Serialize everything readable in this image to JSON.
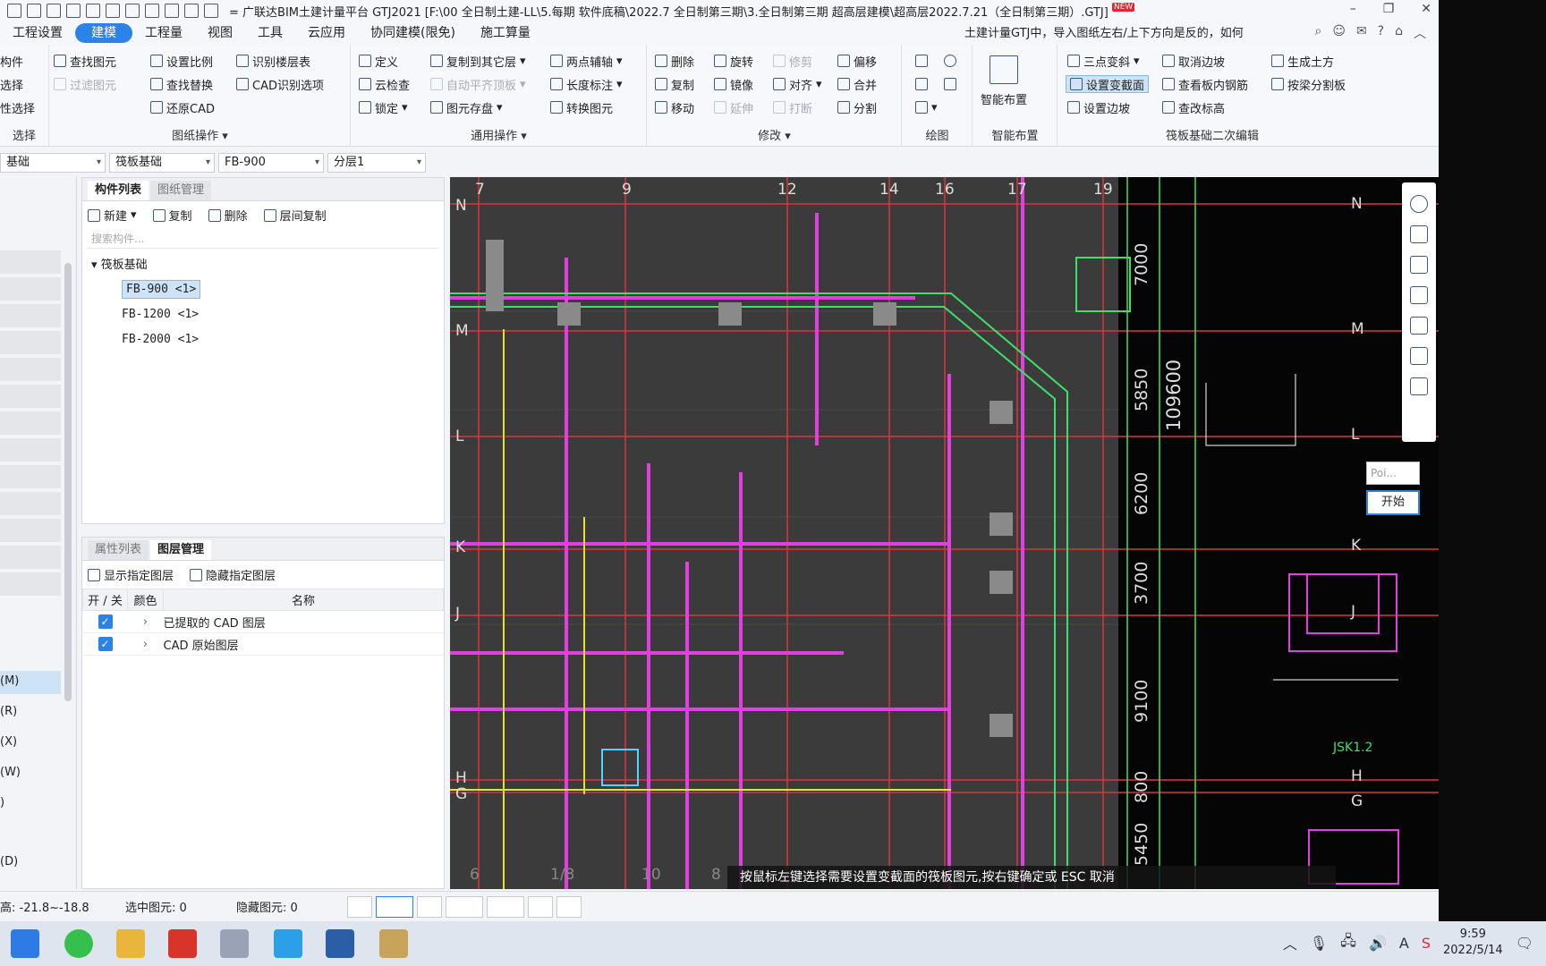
{
  "titlebar": {
    "title": "= 广联达BIM土建计量平台 GTJ2021 [F:\\00 全日制土建-LL\\5.每期 软件底稿\\2022.7 全日制第三期\\3.全日制第三期 超高层建模\\超高层2022.7.21（全日制第三期）.GTJ]",
    "new_badge": "NEW"
  },
  "menubar": {
    "items": [
      "工程设置",
      "建模",
      "工程量",
      "视图",
      "工具",
      "云应用",
      "协同建模(限免)",
      "施工算量"
    ],
    "active": "建模",
    "tip": "土建计量GTJ中，导入图纸左右/上下方向是反的，如何"
  },
  "ribbon": {
    "select_group": {
      "title": "选择",
      "items": [
        "构件",
        "选择",
        "性选择"
      ]
    },
    "drawing_ops": {
      "title": "图纸操作",
      "items": [
        "查找图元",
        "过滤图元",
        "设置比例",
        "查找替换",
        "还原CAD",
        "识别楼层表",
        "CAD识别选项"
      ]
    },
    "common_ops": {
      "title": "通用操作",
      "items": [
        "定义",
        "云检查",
        "锁定",
        "复制到其它层",
        "自动平齐顶板",
        "图元存盘",
        "两点辅轴",
        "长度标注",
        "转换图元"
      ]
    },
    "modify": {
      "title": "修改",
      "items": [
        "删除",
        "旋转",
        "修剪",
        "偏移",
        "复制",
        "镜像",
        "对齐",
        "合并",
        "移动",
        "延伸",
        "打断",
        "分割"
      ]
    },
    "draw": {
      "title": "绘图"
    },
    "smart": {
      "title": "智能布置",
      "label": "智能布置"
    },
    "raft_edit": {
      "title": "筏板基础二次编辑",
      "items": [
        "三点变斜",
        "取消边坡",
        "生成土方",
        "设置变截面",
        "查看板内钢筋",
        "按梁分割板",
        "设置边坡",
        "查改标高"
      ]
    }
  },
  "selbar": {
    "combos": [
      "基础",
      "筏板基础",
      "FB-900",
      "分层1"
    ]
  },
  "left_strip": {
    "labels": [
      "(M)",
      "(R)",
      "(X)",
      "(W)",
      ")",
      "(D)"
    ]
  },
  "component_panel": {
    "tabs": [
      "构件列表",
      "图纸管理"
    ],
    "toolbar": [
      "新建",
      "复制",
      "删除",
      "层间复制"
    ],
    "search_placeholder": "搜索构件...",
    "tree_root": "筏板基础",
    "items": [
      "FB-900 <1>",
      "FB-1200 <1>",
      "FB-2000 <1>"
    ]
  },
  "layer_panel": {
    "tabs": [
      "属性列表",
      "图层管理"
    ],
    "toolbar": [
      "显示指定图层",
      "隐藏指定图层"
    ],
    "headers": [
      "开 / 关",
      "颜色",
      "名称"
    ],
    "rows": [
      "已提取的 CAD 图层",
      "CAD 原始图层"
    ]
  },
  "canvas": {
    "axis_top": [
      "7",
      "9",
      "12",
      "14",
      "16",
      "17",
      "19"
    ],
    "axis_left": [
      "N",
      "M",
      "L",
      "K",
      "J",
      "H",
      "G"
    ],
    "axis_bottom": [
      "6",
      "1/8",
      "10",
      "8"
    ],
    "dims": [
      "7000",
      "5850",
      "6200",
      "3700",
      "9100",
      "800",
      "5450"
    ],
    "dim_total": "109600",
    "axis_right": [
      "N",
      "M",
      "L",
      "K",
      "J",
      "H",
      "G"
    ],
    "jsk_label": "JSK1.2",
    "hint": "按鼠标左键选择需要设置变截面的筏板图元,按右键确定或 ESC 取消",
    "point_placeholder": "Poi...",
    "start_button": "开始"
  },
  "statusbar": {
    "elevation": "高:  -21.8~-18.8",
    "selected": "选中图元:  0",
    "hidden": "隐藏图元:  0"
  },
  "taskbar": {
    "time": "9:59",
    "date": "2022/5/14"
  }
}
